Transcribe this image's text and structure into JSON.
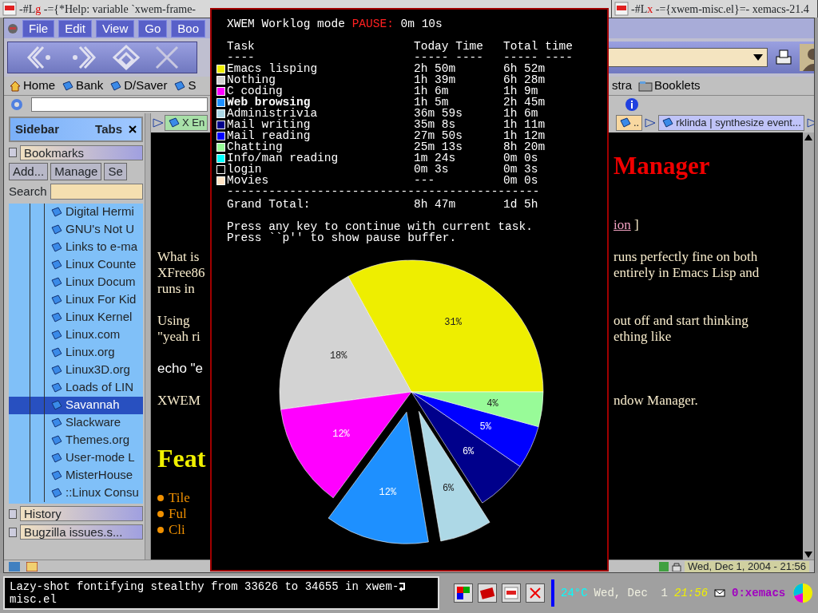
{
  "title_bar": {
    "windows": [
      {
        "prefix": "-#L",
        "flag": "g",
        "title": "-={*Help: variable `xwem-frame-"
      },
      {
        "prefix": "-#L",
        "flag": "x",
        "title": "-={xwem-misc.el}=- xemacs-21.4"
      }
    ]
  },
  "browser": {
    "menu": [
      "File",
      "Edit",
      "View",
      "Go",
      "Boo"
    ],
    "personal_toolbar": [
      {
        "label": "Home",
        "kind": "home"
      },
      {
        "label": "Bank",
        "kind": "bookmark"
      },
      {
        "label": "D/Saver",
        "kind": "bookmark"
      },
      {
        "label": "S",
        "kind": "bookmark"
      }
    ],
    "personal_toolbar_right": [
      {
        "label": "stra",
        "kind": "plain"
      },
      {
        "label": "Booklets",
        "kind": "folder"
      }
    ],
    "tabs_left": [
      {
        "label": "X En",
        "color": "#a8e0a8"
      }
    ],
    "tabs_right": [
      {
        "label": "..",
        "color": "#f8d8a0"
      },
      {
        "label": "rklinda | synthesize event...",
        "color": "#c0c4f8"
      }
    ],
    "content": [
      {
        "kind": "title",
        "right": [
          "Manager"
        ]
      },
      {
        "kind": "nav",
        "right": [
          "ion",
          "]"
        ]
      },
      {
        "kind": "para",
        "left": [
          "What is",
          "XFree86",
          "runs in"
        ],
        "right": [
          "runs perfectly fine on both",
          "entirely in Emacs Lisp and"
        ]
      },
      {
        "kind": "para",
        "left": [
          "Using",
          "\"yeah ri"
        ],
        "right": [
          "out off and start thinking",
          "ething like"
        ]
      },
      {
        "kind": "code",
        "left": [
          "echo \"e"
        ]
      },
      {
        "kind": "para",
        "left": [
          "XWEM"
        ],
        "right": [
          "ndow Manager."
        ]
      },
      {
        "kind": "heading",
        "left": [
          "Feat"
        ]
      },
      {
        "kind": "list",
        "left": [
          "Tile",
          "Ful",
          "Cli"
        ]
      }
    ],
    "status": "Wed, Dec 1, 2004 - 21:56"
  },
  "sidebar": {
    "title": "Sidebar",
    "tabs_label": "Tabs",
    "panel": "Bookmarks",
    "buttons": [
      "Add...",
      "Manage",
      "Se"
    ],
    "search_label": "Search",
    "items": [
      {
        "label": "Digital Hermi",
        "selected": false
      },
      {
        "label": "GNU's Not U",
        "selected": false
      },
      {
        "label": "Links to e-ma",
        "selected": false
      },
      {
        "label": "Linux Counte",
        "selected": false
      },
      {
        "label": "Linux Docum",
        "selected": false
      },
      {
        "label": "Linux For Kid",
        "selected": false
      },
      {
        "label": "Linux Kernel",
        "selected": false
      },
      {
        "label": "Linux.com",
        "selected": false
      },
      {
        "label": "Linux.org",
        "selected": false
      },
      {
        "label": "Linux3D.org",
        "selected": false
      },
      {
        "label": "Loads of LIN",
        "selected": false
      },
      {
        "label": "Savannah",
        "selected": true
      },
      {
        "label": "Slackware",
        "selected": false
      },
      {
        "label": "Themes.org",
        "selected": false
      },
      {
        "label": "User-mode L",
        "selected": false
      },
      {
        "label": "MisterHouse",
        "selected": false
      },
      {
        "label": "::Linux Consu",
        "selected": false
      }
    ],
    "other_panels": [
      "History",
      "Bugzilla issues.s..."
    ]
  },
  "worklog": {
    "title": "XWEM Worklog mode",
    "pause": "PAUSE:",
    "elapsed": "0m 10s",
    "columns": [
      "Task",
      "Today Time",
      "Total time"
    ],
    "underlines": [
      "----",
      "----- ----",
      "----- ----"
    ],
    "tasks": [
      {
        "name": "Emacs lisping",
        "color": "#eeee00",
        "selected": false,
        "exploded": false,
        "today": "2h 50m",
        "total": "6h 52m"
      },
      {
        "name": "Nothing",
        "color": "#d3d3d3",
        "selected": false,
        "exploded": false,
        "today": "1h 39m",
        "total": "6h 28m"
      },
      {
        "name": "C coding",
        "color": "#ff00ff",
        "selected": false,
        "exploded": false,
        "today": "1h 6m",
        "total": "1h 9m"
      },
      {
        "name": "Web browsing",
        "color": "#1e90ff",
        "selected": true,
        "exploded": true,
        "today": "1h 5m",
        "total": "2h 45m"
      },
      {
        "name": "Administrivia",
        "color": "#add8e6",
        "selected": false,
        "exploded": true,
        "today": "36m 59s",
        "total": "1h 6m"
      },
      {
        "name": "Mail writing",
        "color": "#00008b",
        "selected": false,
        "exploded": false,
        "today": "35m 8s",
        "total": "1h 11m"
      },
      {
        "name": "Mail reading",
        "color": "#0000ff",
        "selected": false,
        "exploded": false,
        "today": "27m 50s",
        "total": "1h 12m"
      },
      {
        "name": "Chatting",
        "color": "#98fb98",
        "selected": false,
        "exploded": false,
        "today": "25m 13s",
        "total": "8h 20m"
      },
      {
        "name": "Info/man reading",
        "color": "#00ffff",
        "selected": false,
        "today": "1m 24s",
        "total": "0m 0s"
      },
      {
        "name": "login",
        "color": "#000000",
        "selected": false,
        "today": "0m 3s",
        "total": "0m 3s"
      },
      {
        "name": "Movies",
        "color": "#ffe4c4",
        "selected": false,
        "today": "---",
        "total": "0m 0s"
      }
    ],
    "rule": "---------------------------------------------",
    "grand_total": {
      "label": "Grand Total:",
      "today": "8h 47m",
      "total": "1d 5h"
    },
    "hints": [
      "Press any key to continue with current task.",
      "Press ``p'' to show pause buffer."
    ],
    "chart_data": {
      "type": "pie",
      "values": [
        31,
        18,
        12,
        12,
        6,
        6,
        5,
        4
      ],
      "value_labels": [
        "31%",
        "18%",
        "12%",
        "12%",
        "6%",
        "6%",
        "5%",
        "4%"
      ]
    }
  },
  "panel": {
    "message": [
      "Lazy-shot fontifying stealthy from 33626 to 34655 in xwem-",
      "misc.el"
    ],
    "temperature": "24°C",
    "date": "Wed, Dec  1",
    "time": "21:56",
    "desktop": "0:xemacs"
  }
}
